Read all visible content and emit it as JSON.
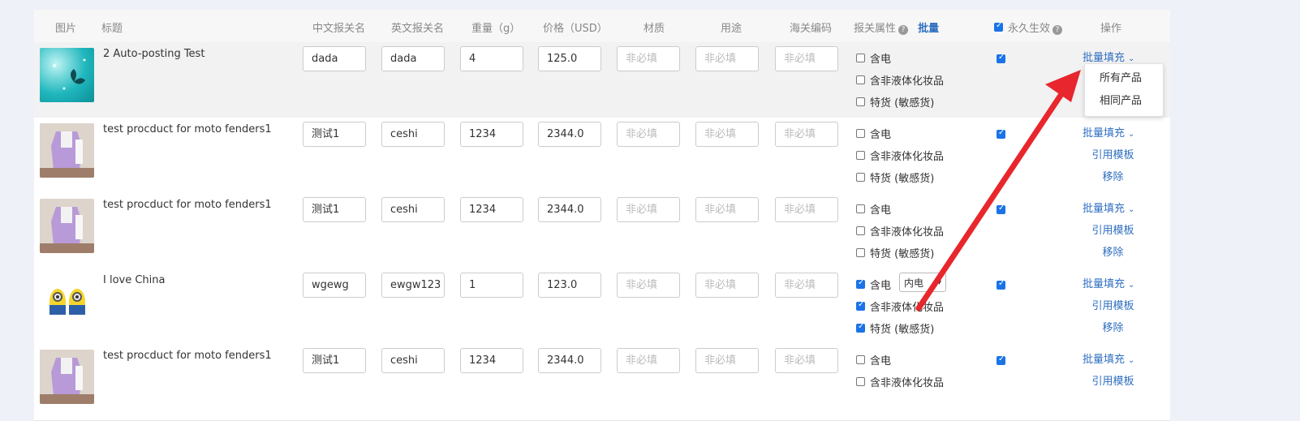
{
  "header": {
    "image": "图片",
    "title": "标题",
    "cn_name": "中文报关名",
    "en_name": "英文报关名",
    "weight": "重量（g）",
    "price": "价格（USD）",
    "material": "材质",
    "usage": "用途",
    "hs_code": "海关编码",
    "attr": "报关属性",
    "bulk": "批量",
    "permanent": "永久生效",
    "ops": "操作"
  },
  "placeholders": {
    "material": "非必填",
    "usage": "非必填",
    "hs_code": "非必填"
  },
  "attr_labels": {
    "battery": "含电",
    "liquid": "含非液体化妆品",
    "special": "特货 (敏感货)"
  },
  "op_labels": {
    "bulk_fill": "批量填充",
    "template": "引用模板",
    "remove": "移除"
  },
  "rows": [
    {
      "title": "2 Auto-posting Test",
      "cn": "dada",
      "en": "dada",
      "weight": "4",
      "price": "125.0",
      "image": "butterfly-teal"
    },
    {
      "title": "test procduct for moto fenders1",
      "cn": "测试1",
      "en": "ceshi",
      "weight": "1234",
      "price": "2344.0",
      "image": "purple-dress"
    },
    {
      "title": "test procduct for moto fenders1",
      "cn": "测试1",
      "en": "ceshi",
      "weight": "1234",
      "price": "2344.0",
      "image": "purple-dress"
    },
    {
      "title": "I love China",
      "cn": "wgewg",
      "en": "ewgw123",
      "weight": "1",
      "price": "123.0",
      "image": "minions",
      "battery_type": "内电"
    },
    {
      "title": "test procduct for moto fenders1",
      "cn": "测试1",
      "en": "ceshi",
      "weight": "1234",
      "price": "2344.0",
      "image": "purple-dress"
    }
  ],
  "dropdown": {
    "all_products": "所有产品",
    "same_products": "相同产品"
  },
  "colors": {
    "link": "#2f6fc0",
    "arrow": "#e8262d",
    "checkbox": "#1a73e8"
  }
}
